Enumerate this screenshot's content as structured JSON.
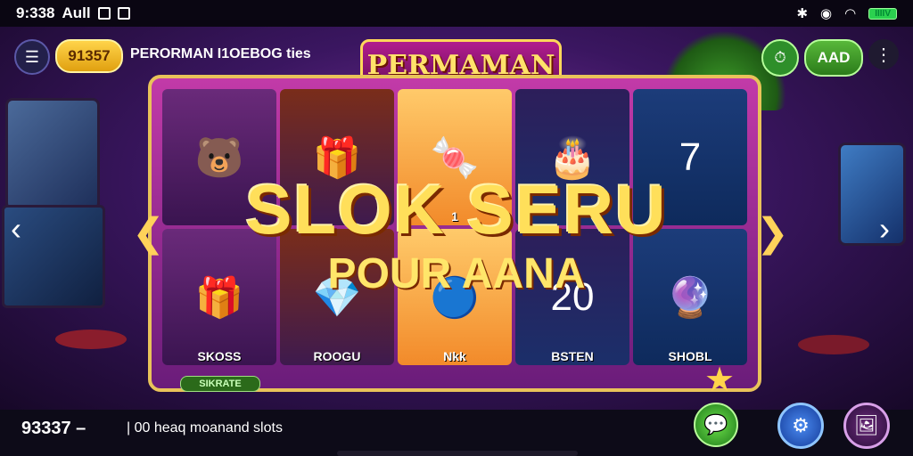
{
  "status_bar": {
    "time": "9:338",
    "signal_text": "Aull",
    "battery_text": "IIIIV"
  },
  "header": {
    "coins": "91357",
    "label": "PERORMAN I1OEBOG ties",
    "logo": "PERMAMAN",
    "add_label": "AAD"
  },
  "game": {
    "title_line1": "SLOK SERU",
    "title_line2": "POUR AANA",
    "reels": [
      {
        "symbol": "🐻",
        "label": ""
      },
      {
        "symbol": "🎁",
        "label": ""
      },
      {
        "symbol": "🍬",
        "label": "1"
      },
      {
        "symbol": "🎂",
        "label": ""
      },
      {
        "symbol": "7",
        "label": ""
      },
      {
        "symbol": "🎁",
        "label": "SKOSS"
      },
      {
        "symbol": "💎",
        "label": "ROOGU"
      },
      {
        "symbol": "🔵",
        "label": "Nkk"
      },
      {
        "symbol": "20",
        "label": "BSTEN"
      },
      {
        "symbol": "🔮",
        "label": "SHOBL"
      }
    ],
    "frame_tag": "SIKRATE"
  },
  "bottom": {
    "balance": "93337 –",
    "divider": "|",
    "caption": "00 heaq moanand slots"
  },
  "colors": {
    "accent": "#ffd44a",
    "frame": "#c23aa8",
    "green": "#2b7c1a",
    "blue": "#153c9a"
  },
  "icons": [
    "menu-icon",
    "timer-icon",
    "more-icon",
    "arrow-left-icon",
    "arrow-right-icon",
    "chat-icon",
    "settings-icon",
    "gallery-icon",
    "star-icon"
  ]
}
